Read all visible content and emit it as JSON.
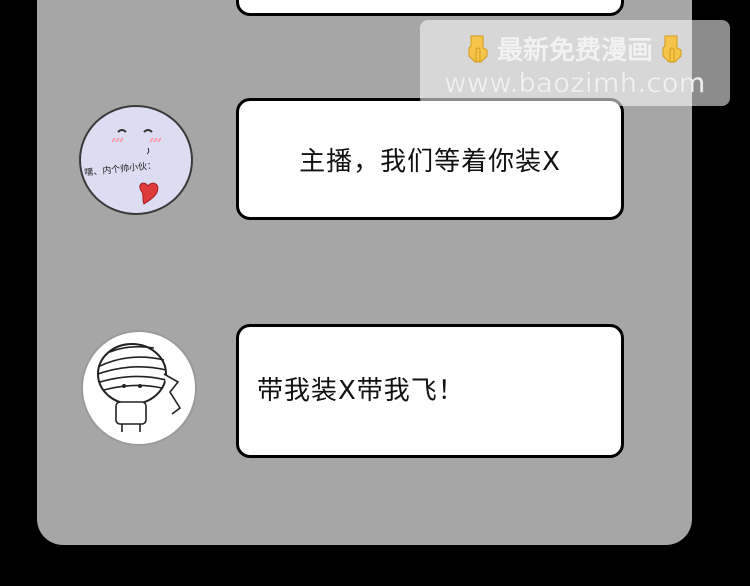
{
  "messages": [
    {
      "text": "主播，我们等着你装X"
    },
    {
      "text": "带我装X带我飞！"
    }
  ],
  "avatar_1": {
    "caption": "嘿、内个帅小伙："
  },
  "watermark": {
    "title": "最新免费漫画",
    "url": "www.baozimh.com",
    "icon": "pointing-down-hand-icon"
  },
  "colors": {
    "background": "#000000",
    "panel": "#a6a6a6",
    "bubble": "#ffffff",
    "avatar_1_face": "#dcdcf3",
    "avatar_1_heart": "#e03b3b"
  }
}
